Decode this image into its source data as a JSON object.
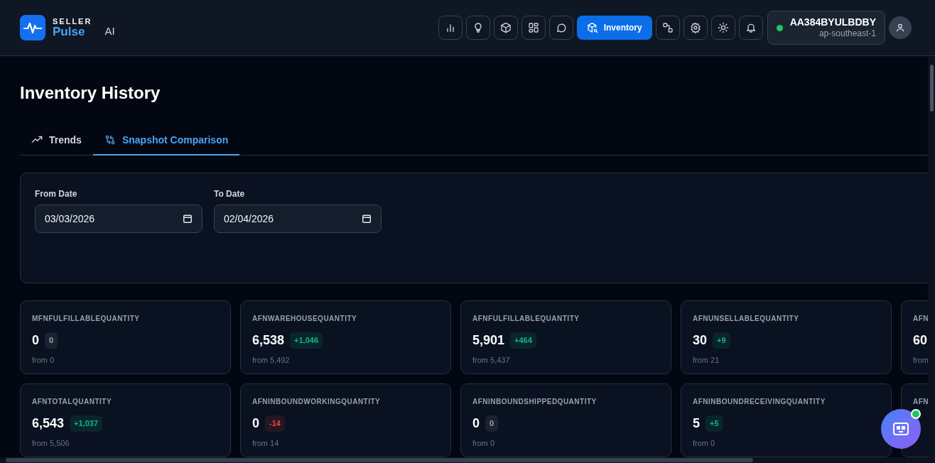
{
  "brand": {
    "top": "SELLER",
    "name": "Pulse",
    "suffix": "AI"
  },
  "toolbar": [
    {
      "kind": "chart",
      "selected": false
    },
    {
      "kind": "bulb",
      "selected": false
    },
    {
      "kind": "box",
      "selected": false
    },
    {
      "kind": "grid",
      "selected": false
    },
    {
      "kind": "chat",
      "selected": false
    },
    {
      "kind": "inventory",
      "label": "Inventory",
      "selected": true
    },
    {
      "kind": "flow",
      "selected": false
    },
    {
      "kind": "gear",
      "selected": false
    },
    {
      "kind": "sun",
      "selected": false
    },
    {
      "kind": "bell",
      "selected": false
    }
  ],
  "account": {
    "id": "AA384BYULBDBY",
    "region": "ap-southeast-1",
    "online": true
  },
  "page_title": "Inventory History",
  "tabs": [
    {
      "kind": "trend",
      "label": "Trends",
      "selected": false
    },
    {
      "kind": "compare",
      "label": "Snapshot Comparison",
      "selected": true
    }
  ],
  "filters": [
    {
      "label": "From Date",
      "value": "03/03/2026"
    },
    {
      "label": "To Date",
      "value": "02/04/2026"
    }
  ],
  "cards": [
    {
      "label": "MFNFULFILLABLEQUANTITY",
      "value": "0",
      "delta": "0",
      "color": "#9ca3af",
      "from": "from 0"
    },
    {
      "label": "AFNWAREHOUSEQUANTITY",
      "value": "6,538",
      "delta": "+1,046",
      "color": "#10b981",
      "from": "from 5,492"
    },
    {
      "label": "AFNFULFILLABLEQUANTITY",
      "value": "5,901",
      "delta": "+464",
      "color": "#10b981",
      "from": "from 5,437"
    },
    {
      "label": "AFNUNSELLABLEQUANTITY",
      "value": "30",
      "delta": "+9",
      "color": "#10b981",
      "from": "from 21"
    },
    {
      "label": "AFN",
      "value": "60",
      "from": "from"
    },
    {
      "label": "AFNTOTALQUANTITY",
      "value": "6,543",
      "delta": "+1,037",
      "color": "#10b981",
      "from": "from 5,506"
    },
    {
      "label": "AFNINBOUNDWORKINGQUANTITY",
      "value": "0",
      "delta": "-14",
      "color": "#ef4444",
      "from": "from 14"
    },
    {
      "label": "AFNINBOUNDSHIPPEDQUANTITY",
      "value": "0",
      "delta": "0",
      "color": "#9ca3af",
      "from": "from 0"
    },
    {
      "label": "AFNINBOUNDRECEIVINGQUANTITY",
      "value": "5",
      "delta": "+5",
      "color": "#10b981",
      "from": "from 0"
    },
    {
      "label": "AFN"
    }
  ],
  "assistant": {
    "online": true
  }
}
